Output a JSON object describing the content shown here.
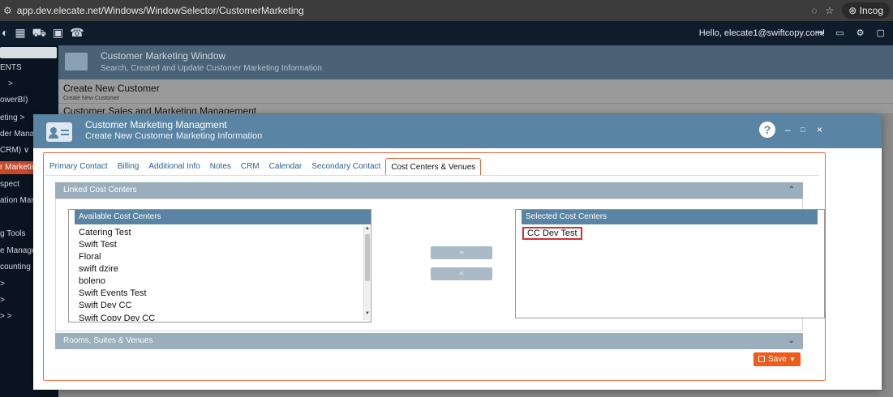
{
  "browser": {
    "url": "app.dev.elecate.net/Windows/WindowSelector/CustomerMarketing",
    "incognito_label": "Incog"
  },
  "app_top": {
    "greeting": "Hello, elecate1@swiftcopy.com!"
  },
  "sidebar": {
    "items": [
      "ENTS",
      ">",
      "owerBI)",
      "eting  >",
      "der Mana..",
      "CRM)  ∨",
      "r Marketin",
      "spect",
      "ation Mana",
      "g Tools",
      "e Manage",
      "counting",
      ">",
      ">",
      ">  >"
    ]
  },
  "background": {
    "window_title": "Customer Marketing Window",
    "window_subtitle": "Search, Created and Update Customer Marketing Information",
    "row1_title": "Create New Customer",
    "row1_sub": "Create New Customer",
    "row2_title": "Customer Sales and Marketing Management"
  },
  "modal": {
    "title": "Customer Marketing Managment",
    "subtitle": "Create New Customer Marketing Information",
    "help": "?",
    "minimize": "–",
    "maximize": "□",
    "close": "×"
  },
  "tabs": [
    "Primary Contact",
    "Billing",
    "Additional Info",
    "Notes",
    "CRM",
    "Calendar",
    "Secondary Contact",
    "Cost Centers & Venues"
  ],
  "active_tab": "Cost Centers & Venues",
  "linked_panel": {
    "title": "Linked Cost Centers",
    "chevron": "⌃"
  },
  "available": {
    "header": "Available Cost Centers",
    "items": [
      "Catering Test",
      "Swift Test",
      "Floral",
      "swift dzire",
      "boleno",
      "Swift Events Test",
      "Swift Dev CC",
      "Swift Copy Dev CC"
    ]
  },
  "move_buttons": {
    "add": "»",
    "remove": "«"
  },
  "selected": {
    "header": "Selected Cost Centers",
    "items": [
      "CC Dev Test"
    ]
  },
  "rooms_panel": {
    "title": "Rooms, Suites & Venues",
    "chevron": "⌄"
  },
  "save": {
    "label": "Save",
    "caret": "▼"
  },
  "colors": {
    "accent": "#f05a1a",
    "header_blue": "#5a84a3",
    "panel_bar": "#9aaebb"
  }
}
